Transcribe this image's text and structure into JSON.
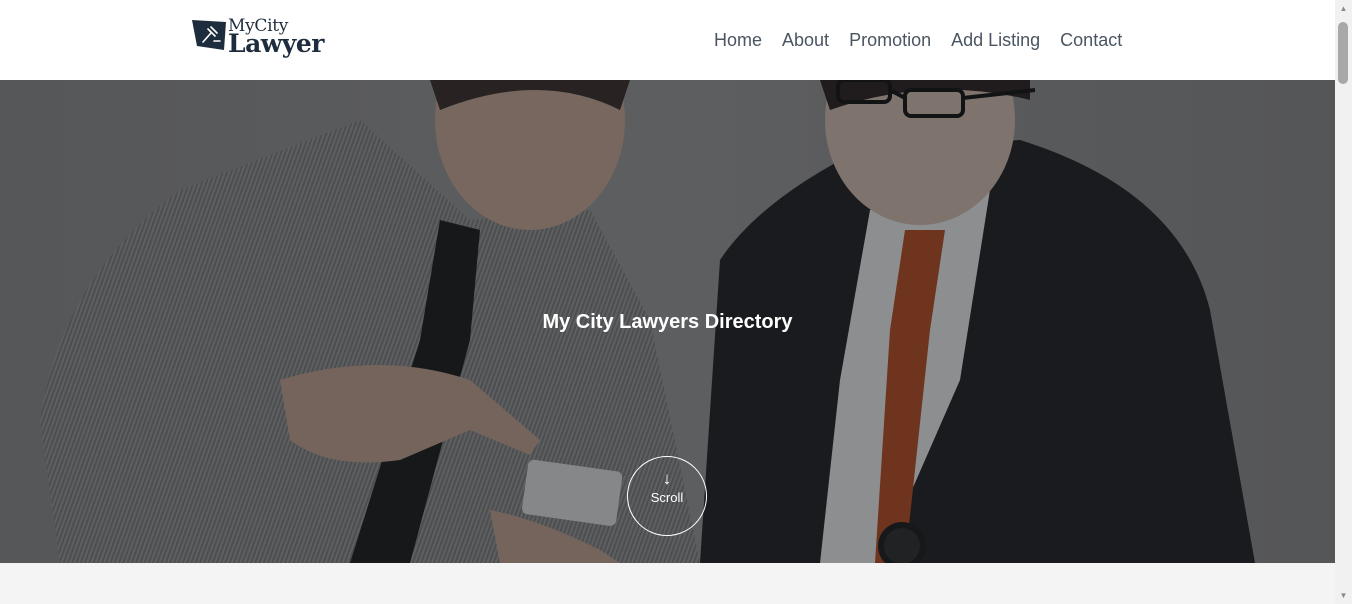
{
  "brand": {
    "logo_top": "MyCity",
    "logo_bottom": "Lawyer",
    "logo_icon": "gavel-icon"
  },
  "nav": {
    "items": [
      {
        "label": "Home"
      },
      {
        "label": "About"
      },
      {
        "label": "Promotion"
      },
      {
        "label": "Add Listing"
      },
      {
        "label": "Contact"
      }
    ]
  },
  "hero": {
    "title": "My City Lawyers Directory",
    "scroll_label": "Scroll",
    "scroll_icon": "arrow-down-icon"
  },
  "colors": {
    "brand": "#1e2d3d",
    "nav_text": "#4a5561",
    "header_bg": "#ffffff",
    "hero_overlay": "#14161a",
    "section_bg": "#f4f4f4"
  }
}
